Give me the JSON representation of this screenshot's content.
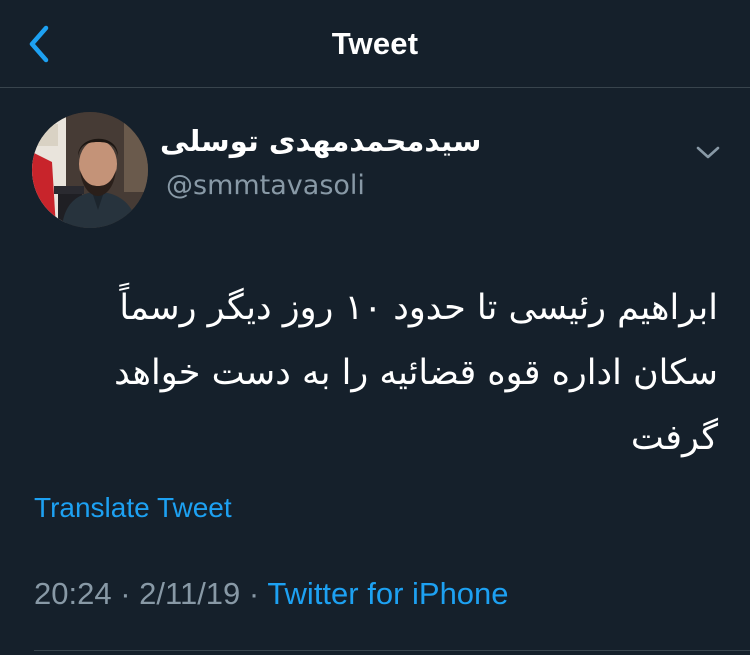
{
  "header": {
    "title": "Tweet",
    "back_icon": "chevron-left-icon",
    "accent_color": "#1da1f2"
  },
  "author": {
    "display_name": "سیدمحمدمهدی توسلی",
    "handle": "@smmtavasoli",
    "avatar": "profile-photo",
    "menu_icon": "chevron-down-icon"
  },
  "tweet": {
    "lines": [
      "ابراهیم رئیسی تا حدود ۱۰ روز دیگر رسماً",
      "سکان اداره قوه قضائیه را به دست خواهد",
      "گرفت"
    ],
    "translate_label": "Translate Tweet"
  },
  "meta": {
    "time": "20:24",
    "separator": "·",
    "date": "2/11/19",
    "source": "Twitter for iPhone"
  },
  "colors": {
    "background": "#15202b",
    "secondary_text": "#8899a6",
    "divider": "#38444d"
  }
}
